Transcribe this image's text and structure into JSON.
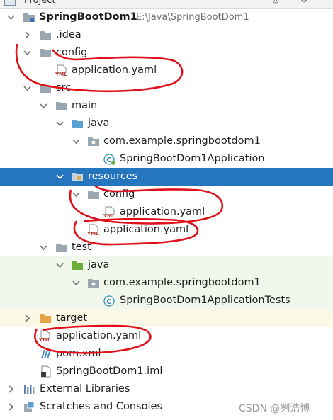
{
  "header": {
    "title": "Project"
  },
  "tree": {
    "root_name": "SpringBootDom1",
    "root_path": "E:\\Java\\SpringBootDom1",
    "idea": ".idea",
    "config": "config",
    "config_yaml": "application.yaml",
    "src": "src",
    "main": "main",
    "main_java": "java",
    "main_pkg": "com.example.springbootdom1",
    "main_class": "SpringBootDom1Application",
    "resources": "resources",
    "res_config": "config",
    "res_config_yaml": "application.yaml",
    "res_yaml": "application.yaml",
    "test": "test",
    "test_java": "java",
    "test_pkg": "com.example.springbootdom1",
    "test_class": "SpringBootDom1ApplicationTests",
    "target": "target",
    "root_yaml": "application.yaml",
    "pom": "pom.xml",
    "iml": "SpringBootDom1.iml",
    "ext_libs": "External Libraries",
    "scratches": "Scratches and Consoles"
  },
  "watermark": "CSDN @刿浩博",
  "colors": {
    "selection": "#2675bf",
    "annotation": "#e0101a",
    "folder": "#9aa7b0",
    "source_folder": "#5a9fd6",
    "test_folder": "#6aaf3a",
    "target_folder": "#e7a346"
  }
}
